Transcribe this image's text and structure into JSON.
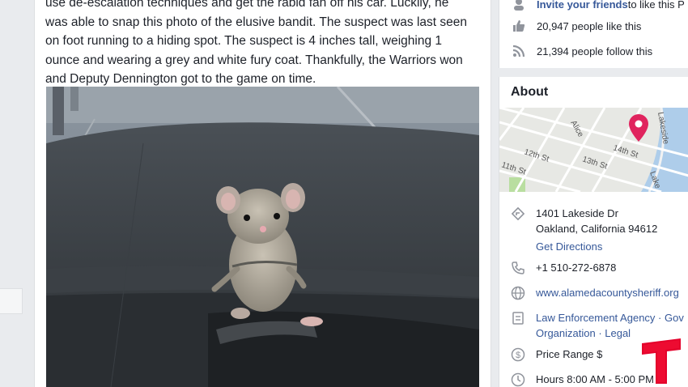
{
  "post": {
    "text_lines": [
      "use de-escalation techniques and get the rabid fan off his car. Luckily, he",
      "was able to snap this photo of the elusive bandit. The suspect was last seen",
      "on foot running to a hiding spot. The suspect is 4 inches tall, weighing 1",
      "ounce and wearing a grey and white fury coat. Thankfully, the Warriors won",
      "and Deputy Dennington got to the game on time."
    ],
    "photo_subject": "mouse-on-dashboard"
  },
  "stats": {
    "invite_link": "Invite your friends",
    "invite_rest": " to like this P",
    "likes": "20,947 people like this",
    "follows": "21,394 people follow this"
  },
  "about": {
    "title": "About",
    "map": {
      "streets": [
        "Alice",
        "14th St",
        "12th St",
        "13th St",
        "11th St",
        "Lakeside",
        "Lake"
      ],
      "pin_color": "#e0245e"
    },
    "address_line1": "1401 Lakeside Dr",
    "address_line2": "Oakland, California 94612",
    "directions": "Get Directions",
    "phone": "+1 510-272-6878",
    "website": "www.alamedacountysheriff.org",
    "category_line1": "Law Enforcement Agency · Gov",
    "category_line2": "Organization · Legal",
    "price": "Price Range $",
    "hours": "Hours 8:00 AM - 5:00 PM"
  },
  "colors": {
    "link": "#365899",
    "text": "#1d2129",
    "icon": "#90949c",
    "brand_red": "#e4002b"
  }
}
